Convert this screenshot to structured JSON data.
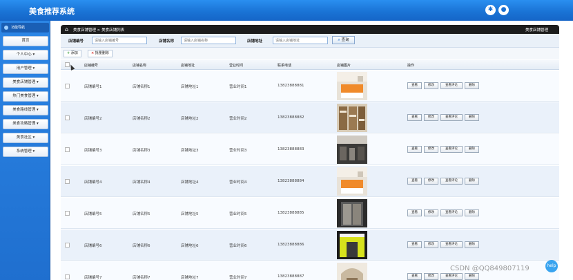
{
  "app": {
    "title": "美食推荐系统"
  },
  "top_icons": [
    {
      "name": "settings-icon",
      "glyph": "⚙"
    },
    {
      "name": "user-icon",
      "glyph": "👤"
    }
  ],
  "sidebar": {
    "header": "功能导航",
    "items": [
      {
        "label": "首页",
        "key": "home"
      },
      {
        "label": "个人中心 ▾",
        "key": "personal-center"
      },
      {
        "label": "用户管理 ▾",
        "key": "user-management"
      },
      {
        "label": "美食店铺管理 ▾",
        "key": "shop-management"
      },
      {
        "label": "热门美食管理 ▾",
        "key": "popular-food-management"
      },
      {
        "label": "美食路线管理 ▾",
        "key": "route-management"
      },
      {
        "label": "美食攻略管理 ▾",
        "key": "guide-management"
      },
      {
        "label": "美食社区 ▾",
        "key": "food-community"
      },
      {
        "label": "系统管理 ▾",
        "key": "system-management"
      }
    ]
  },
  "breadcrumb": {
    "text": "美食店铺管理 > 美食店铺列表",
    "right": "美食店铺管理"
  },
  "search": {
    "fields": [
      {
        "label": "店铺编号",
        "placeholder": "请输入店铺编号",
        "value": ""
      },
      {
        "label": "店铺名称",
        "placeholder": "请输入店铺名称",
        "value": ""
      },
      {
        "label": "店铺地址",
        "placeholder": "请输入店铺地址",
        "value": ""
      }
    ],
    "button": "查询"
  },
  "toolbar": {
    "add": "添加",
    "batch_delete": "批量删除"
  },
  "table": {
    "headers": [
      "店铺编号",
      "店铺名称",
      "店铺地址",
      "营业时间",
      "联系电话",
      "店铺图片",
      "操作"
    ],
    "actions": [
      "查看",
      "修改",
      "查看评论",
      "删除"
    ],
    "rows": [
      {
        "id": "店铺编号1",
        "name": "店铺名称1",
        "address": "店铺地址1",
        "hours": "营业时间1",
        "phone": "13823888881",
        "image": "counter-orange"
      },
      {
        "id": "店铺编号2",
        "name": "店铺名称2",
        "address": "店铺地址2",
        "hours": "营业时间2",
        "phone": "13823888882",
        "image": "shelves"
      },
      {
        "id": "店铺编号3",
        "name": "店铺名称3",
        "address": "店铺地址3",
        "hours": "营业时间3",
        "phone": "13823888883",
        "image": "dark-interior"
      },
      {
        "id": "店铺编号4",
        "name": "店铺名称4",
        "address": "店铺地址4",
        "hours": "营业时间4",
        "phone": "13823888884",
        "image": "counter-orange"
      },
      {
        "id": "店铺编号5",
        "name": "店铺名称5",
        "address": "店铺地址5",
        "hours": "营业时间5",
        "phone": "13823888885",
        "image": "glass-door"
      },
      {
        "id": "店铺编号6",
        "name": "店铺名称6",
        "address": "店铺地址6",
        "hours": "营业时间6",
        "phone": "13823888886",
        "image": "yellow-store"
      },
      {
        "id": "店铺编号7",
        "name": "店铺名称7",
        "address": "店铺地址7",
        "hours": "营业时间7",
        "phone": "13823888887",
        "image": "arch-interior"
      }
    ]
  },
  "watermark": "CSDN @QQ849807119",
  "help": "help"
}
